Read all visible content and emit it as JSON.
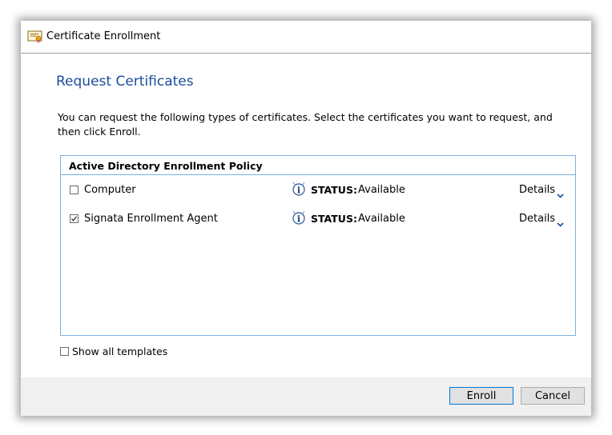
{
  "window": {
    "title": "Certificate Enrollment",
    "icon": "certificate-icon"
  },
  "page": {
    "heading": "Request Certificates",
    "intro": "You can request the following types of certificates. Select the certificates you want to request, and then click Enroll."
  },
  "policy": {
    "title": "Active Directory Enrollment Policy",
    "certificates": [
      {
        "name": "Computer",
        "checked": false,
        "status_label": "STATUS:",
        "status_value": "Available",
        "details_label": "Details"
      },
      {
        "name": "Signata Enrollment Agent",
        "checked": true,
        "status_label": "STATUS:",
        "status_value": "Available",
        "details_label": "Details"
      }
    ]
  },
  "options": {
    "show_all_label": "Show all templates",
    "show_all_checked": false
  },
  "buttons": {
    "enroll": "Enroll",
    "cancel": "Cancel"
  },
  "colors": {
    "heading": "#1a4c9b",
    "list_border": "#7ab0df",
    "footer_bg": "#f0f0f0",
    "default_button_border": "#0078d7"
  }
}
